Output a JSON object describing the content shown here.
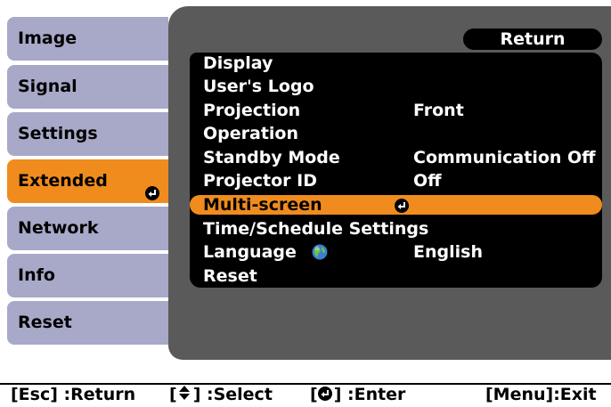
{
  "sidebar": {
    "items": [
      {
        "label": "Image"
      },
      {
        "label": "Signal"
      },
      {
        "label": "Settings"
      },
      {
        "label": "Extended"
      },
      {
        "label": "Network"
      },
      {
        "label": "Info"
      },
      {
        "label": "Reset"
      }
    ],
    "active_item": "Extended"
  },
  "header": {
    "return_label": "Return"
  },
  "menu": {
    "rows": [
      {
        "label": "Display",
        "value": ""
      },
      {
        "label": "User's Logo",
        "value": ""
      },
      {
        "label": "Projection",
        "value": "Front"
      },
      {
        "label": "Operation",
        "value": ""
      },
      {
        "label": "Standby Mode",
        "value": "Communication Off"
      },
      {
        "label": "Projector ID",
        "value": "Off"
      },
      {
        "label": "Multi-screen",
        "value": ""
      },
      {
        "label": "Time/Schedule Settings",
        "value": ""
      },
      {
        "label": "Language",
        "value": "English"
      },
      {
        "label": "Reset",
        "value": ""
      }
    ],
    "selected_item": "Multi-screen"
  },
  "footer": {
    "esc_hint": "[Esc] :Return",
    "select_hint_prefix": "[",
    "select_hint_suffix": "] :Select",
    "enter_hint_prefix": "[",
    "enter_hint_suffix": "] :Enter",
    "menu_hint": "[Menu]:Exit"
  },
  "colors": {
    "accent": "#f08c1e",
    "tab": "#a8a8c8",
    "panel": "#5a5a5a",
    "menu_bg": "#000000"
  },
  "icons": {
    "enter": "enter-icon",
    "globe": "globe-icon",
    "updown": "up-down-arrow-icon"
  }
}
